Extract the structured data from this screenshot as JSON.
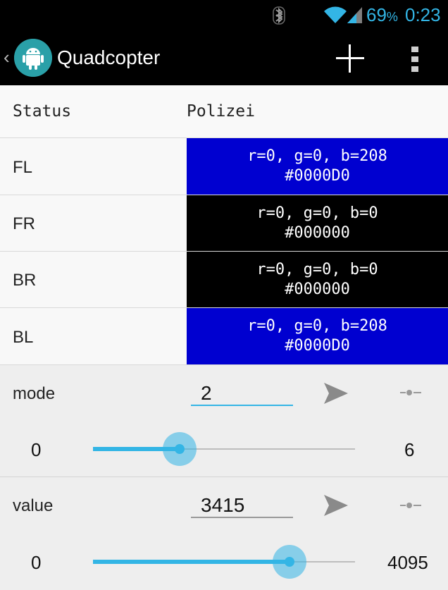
{
  "status_bar": {
    "battery_value": "69",
    "battery_unit": "%",
    "time": "0:23",
    "icons": [
      "bluetooth-icon",
      "wifi-icon",
      "signal-icon"
    ]
  },
  "action_bar": {
    "title": "Quadcopter",
    "icons": [
      "up-arrow-icon",
      "android-logo-icon",
      "add-icon",
      "overflow-menu-icon"
    ]
  },
  "status_row": {
    "label": "Status",
    "value": "Polizei"
  },
  "leds": [
    {
      "label": "FL",
      "rgb": "r=0, g=0, b=208",
      "hex": "#0000D0"
    },
    {
      "label": "FR",
      "rgb": "r=0, g=0, b=0",
      "hex": "#000000"
    },
    {
      "label": "BR",
      "rgb": "r=0, g=0, b=0",
      "hex": "#000000"
    },
    {
      "label": "BL",
      "rgb": "r=0, g=0, b=208",
      "hex": "#0000D0"
    }
  ],
  "controls": [
    {
      "label": "mode",
      "value": "2",
      "min": "0",
      "max": "6",
      "slider_value": 2,
      "slider_max": 6
    },
    {
      "label": "value",
      "value": "3415",
      "min": "0",
      "max": "4095",
      "slider_value": 3415,
      "slider_max": 4095
    }
  ],
  "colors": {
    "accent": "#33b5e5",
    "led_blue": "#0000D0",
    "led_off": "#000000"
  }
}
